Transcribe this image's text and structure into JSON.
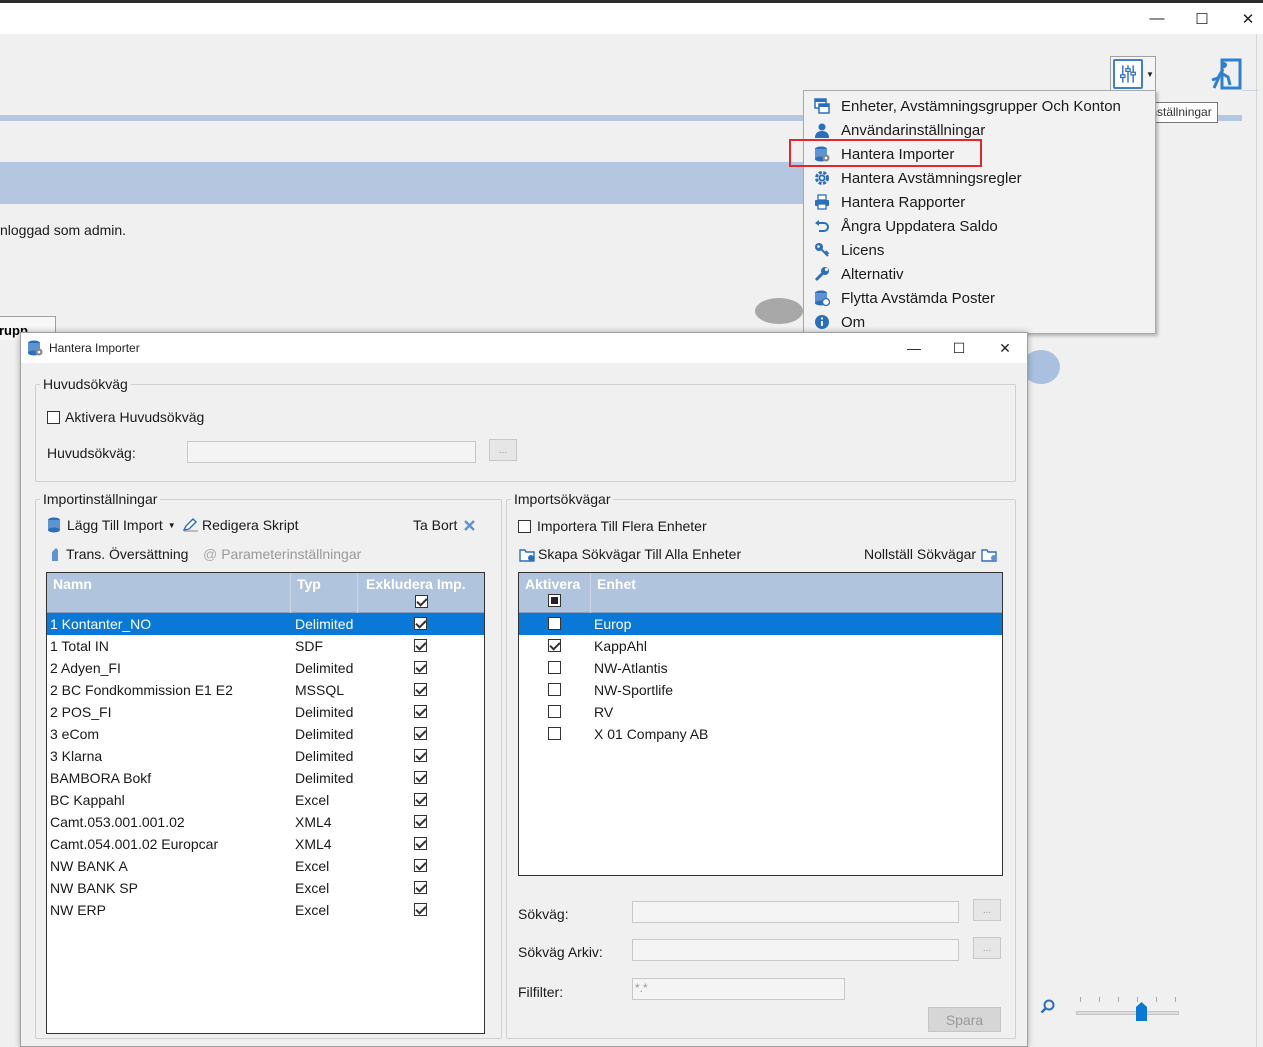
{
  "window": {
    "minimize": "—",
    "maximize": "☐",
    "close": "✕"
  },
  "main": {
    "logged_in_text": "nloggad som admin.",
    "group_tab": "rupp"
  },
  "toolbar": {
    "settings_icon": "sliders-icon",
    "exit_icon": "exit-icon",
    "tooltip": "Inställningar"
  },
  "menu": {
    "items": [
      {
        "label": "Enheter, Avstämningsgrupper Och Konton",
        "icon": "windows-icon"
      },
      {
        "label": "Användarinställningar",
        "icon": "user-icon"
      },
      {
        "label": "Hantera Importer",
        "icon": "database-gear-icon"
      },
      {
        "label": "Hantera Avstämningsregler",
        "icon": "gear-icon"
      },
      {
        "label": "Hantera Rapporter",
        "icon": "printer-icon"
      },
      {
        "label": "Ångra Uppdatera Saldo",
        "icon": "undo-icon"
      },
      {
        "label": "Licens",
        "icon": "key-icon"
      },
      {
        "label": "Alternativ",
        "icon": "wrench-icon"
      },
      {
        "label": "Flytta Avstämda Poster",
        "icon": "database-move-icon"
      },
      {
        "label": "Om",
        "icon": "info-icon"
      }
    ],
    "highlighted_index": 2
  },
  "dialog": {
    "title": "Hantera Importer",
    "minimize": "—",
    "maximize": "☐",
    "close": "✕",
    "main_path": {
      "group_title": "Huvudsökväg",
      "activate_label": "Aktivera Huvudsökväg",
      "activate_checked": false,
      "path_label": "Huvudsökväg:",
      "path_value": "",
      "browse": "..."
    },
    "import_settings": {
      "group_title": "Importinställningar",
      "add_import": "Lägg Till Import",
      "edit_script": "Redigera Skript",
      "delete": "Ta Bort",
      "trans_translation": "Trans. Översättning",
      "param_settings": "Parameterinställningar",
      "columns": [
        "Namn",
        "Typ",
        "Exkludera Imp."
      ],
      "header_checked": true,
      "rows": [
        {
          "name": "1 Kontanter_NO",
          "type": "Delimited",
          "exclude": true,
          "selected": true
        },
        {
          "name": "1 Total IN",
          "type": "SDF",
          "exclude": true
        },
        {
          "name": "2 Adyen_FI",
          "type": "Delimited",
          "exclude": true
        },
        {
          "name": "2 BC Fondkommission E1 E2",
          "type": "MSSQL",
          "exclude": true
        },
        {
          "name": "2 POS_FI",
          "type": "Delimited",
          "exclude": true
        },
        {
          "name": "3 eCom",
          "type": "Delimited",
          "exclude": true
        },
        {
          "name": "3 Klarna",
          "type": "Delimited",
          "exclude": true
        },
        {
          "name": "BAMBORA Bokf",
          "type": "Delimited",
          "exclude": true
        },
        {
          "name": "BC Kappahl",
          "type": "Excel",
          "exclude": true
        },
        {
          "name": "Camt.053.001.001.02",
          "type": "XML4",
          "exclude": true
        },
        {
          "name": "Camt.054.001.02 Europcar",
          "type": "XML4",
          "exclude": true
        },
        {
          "name": "NW BANK A",
          "type": "Excel",
          "exclude": true
        },
        {
          "name": "NW BANK SP",
          "type": "Excel",
          "exclude": true
        },
        {
          "name": "NW ERP",
          "type": "Excel",
          "exclude": true
        }
      ]
    },
    "import_paths": {
      "group_title": "Importsökvägar",
      "import_multi": "Importera Till Flera Enheter",
      "import_multi_checked": false,
      "create_paths": "Skapa Sökvägar Till Alla Enheter",
      "reset_paths": "Nollställ Sökvägar",
      "columns": [
        "Aktivera",
        "Enhet"
      ],
      "rows": [
        {
          "unit": "Europ",
          "active": false,
          "selected": true
        },
        {
          "unit": "KappAhl",
          "active": true
        },
        {
          "unit": "NW-Atlantis",
          "active": false
        },
        {
          "unit": "NW-Sportlife",
          "active": false
        },
        {
          "unit": "RV",
          "active": false
        },
        {
          "unit": "X 01 Company AB",
          "active": false
        }
      ],
      "path_label": "Sökväg:",
      "archive_label": "Sökväg Arkiv:",
      "filter_label": "Filfilter:",
      "filter_value": "*.*",
      "browse": "...",
      "save": "Spara"
    }
  },
  "zoom": {
    "icon": "zoom-icon",
    "level_fraction": 0.64
  }
}
